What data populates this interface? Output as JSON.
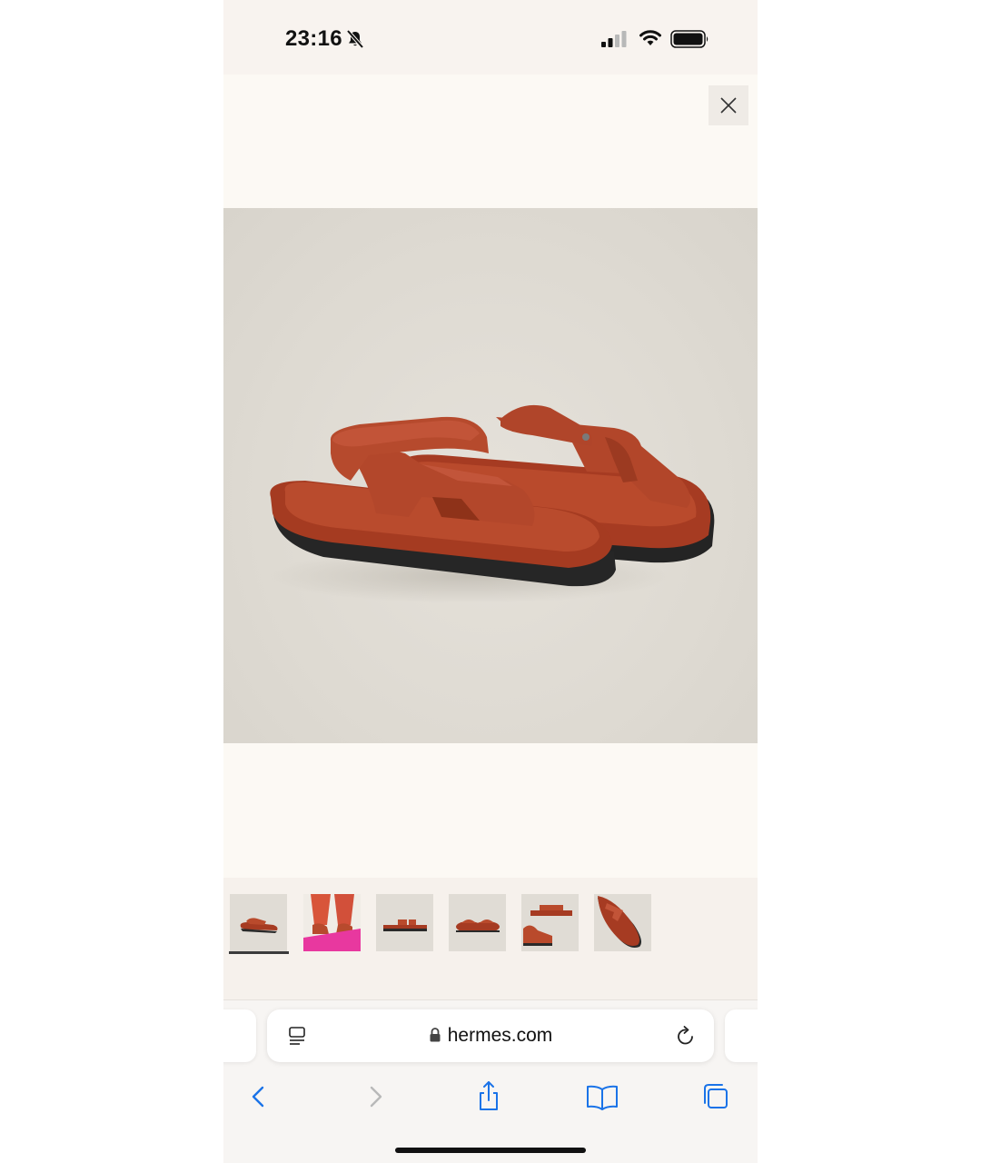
{
  "status_bar": {
    "time": "23:16"
  },
  "viewer": {
    "close_label": "Close",
    "main_image_alt": "Sandal pair, three-quarter view",
    "thumbnails": [
      {
        "name": "thumb-1",
        "selected": true
      },
      {
        "name": "thumb-2",
        "selected": false
      },
      {
        "name": "thumb-3",
        "selected": false
      },
      {
        "name": "thumb-4",
        "selected": false
      },
      {
        "name": "thumb-5",
        "selected": false
      },
      {
        "name": "thumb-6",
        "selected": false
      }
    ]
  },
  "browser": {
    "url": "hermes.com",
    "accent_color": "#1a73e8"
  },
  "colors": {
    "sandal": "#b5452c",
    "sole": "#2a2a2a",
    "background": "#fcf9f4",
    "thumb_pink": "#e8389f"
  }
}
